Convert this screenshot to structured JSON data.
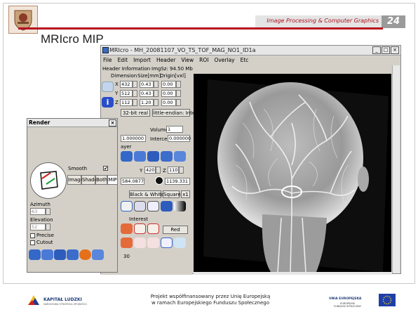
{
  "slide": {
    "header": "Image Processing & Computer Graphics",
    "page": "24",
    "title": "MRIcro MIP",
    "footer": {
      "left_title": "KAPITAŁ LUDZKI",
      "left_sub": "NARODOWA STRATEGIA SPÓJNOŚCI",
      "center": [
        "Projekt współfinansowany przez Unię Europejską",
        "w ramach Europejskiego Funduszu Społecznego"
      ],
      "right_title": "UNIA EUROPEJSKA",
      "right_sub": [
        "EUROPEJSKI",
        "FUNDUSZ SPOŁECZNY"
      ]
    }
  },
  "app": {
    "title": "MRIcro - MH_20081107_VO_TS_TOF_MAG_NO1_ID1a",
    "menu": [
      "File",
      "Edit",
      "Import",
      "Header",
      "View",
      "ROI",
      "Overlay",
      "Etc"
    ],
    "header_info": "Header Information",
    "img_size": "ImgSz: 94.50 Mb",
    "col_headers": [
      "Dimension",
      "Size[mm]",
      "Origin[vxl]"
    ],
    "rows": [
      {
        "axis": "X",
        "dim": "432",
        "size": "0.43",
        "origin": "0.00"
      },
      {
        "axis": "Y",
        "dim": "512",
        "size": "0.43",
        "origin": "0.00"
      },
      {
        "axis": "Z",
        "dim": "112",
        "size": "1.20",
        "origin": "0.00"
      }
    ],
    "datatype": "32-bit real",
    "endian": "little-endian: Intel",
    "volumes_label": "Volumes",
    "volumes": "1",
    "offset_val": "0.000000",
    "scale_val": "1.000000",
    "intercept_label": "Intercept",
    "intercept": "0.000000",
    "layer_label": "ayer",
    "coord_y_label": "Y",
    "coord_y": "420",
    "coord_z_label": "Z",
    "coord_z": "110",
    "contrast_min": "584.0877",
    "contrast_max": "1139.331",
    "color_label": "Black & White",
    "square_label": "Square",
    "zoom_label": "x1",
    "roi_label": "Interest",
    "red_label": "Red",
    "bottom_val": "30"
  },
  "render": {
    "title": "Render",
    "smooth_label": "Smooth",
    "smooth_checked": "✔",
    "tabs": [
      "Image",
      "Shade",
      "Both",
      "MIP"
    ],
    "azimuth_label": "Azimuth",
    "azimuth": "63",
    "elevation_label": "Elevation",
    "elevation": "52",
    "precise_label": "Precise",
    "cutout_label": "Cutout"
  },
  "colors": {
    "accent_red": "#b80f1f",
    "window_face": "#d4d0c8",
    "icon_blue": "#3468c8"
  }
}
